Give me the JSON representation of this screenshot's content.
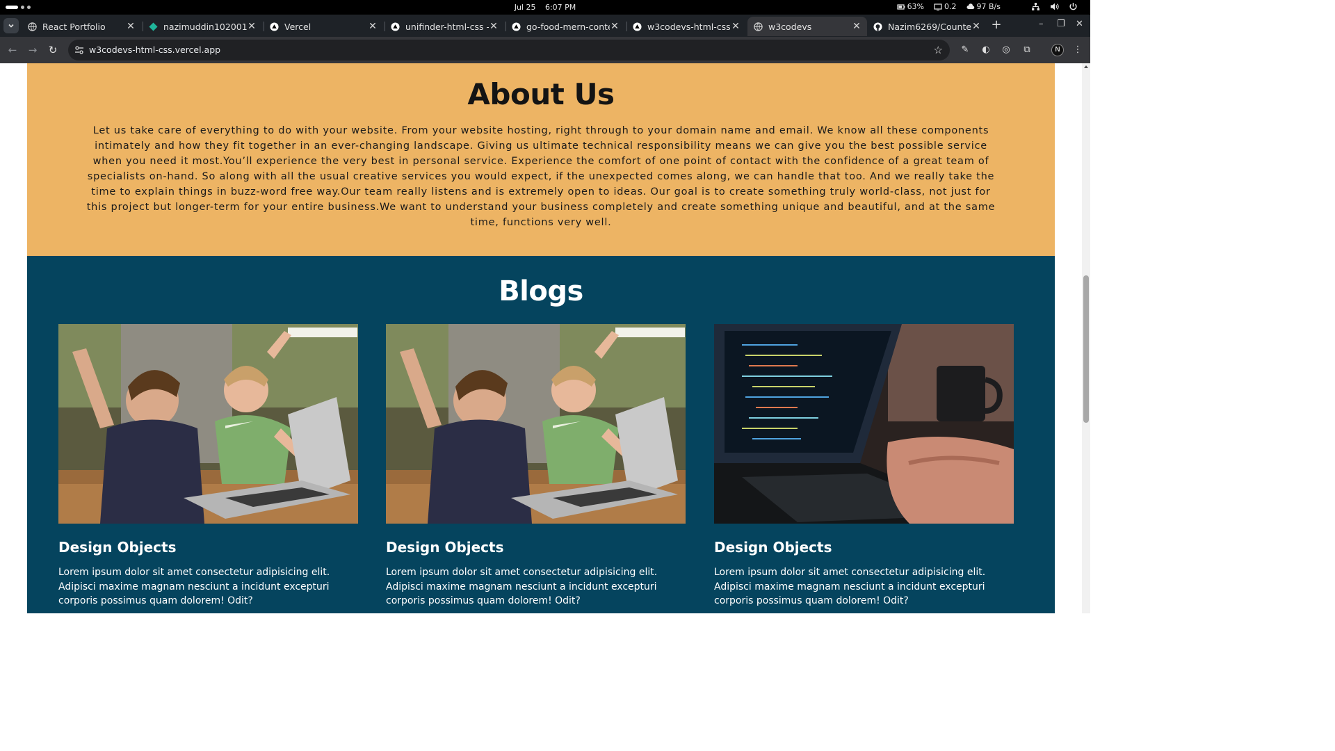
{
  "os": {
    "date": "Jul 25",
    "time": "6:07 PM",
    "battery": "63%",
    "cpu": "0.2",
    "network": "97 B/s"
  },
  "tabs": [
    {
      "title": "React Portfolio",
      "favicon": "globe-icon",
      "active": false
    },
    {
      "title": "nazimuddin102001 |",
      "favicon": "diamond-icon",
      "active": false
    },
    {
      "title": "Vercel",
      "favicon": "vercel-triangle-icon",
      "active": false
    },
    {
      "title": "unifinder-html-css - (",
      "favicon": "vercel-triangle-icon",
      "active": false
    },
    {
      "title": "go-food-mern-conte",
      "favicon": "vercel-triangle-icon",
      "active": false
    },
    {
      "title": "w3codevs-html-css -",
      "favicon": "vercel-triangle-icon",
      "active": false
    },
    {
      "title": "w3codevs",
      "favicon": "globe-icon",
      "active": true
    },
    {
      "title": "Nazim6269/Counter",
      "favicon": "github-icon",
      "active": false
    }
  ],
  "address": {
    "url": "w3codevs-html-css.vercel.app"
  },
  "profile": {
    "initial": "N"
  },
  "about": {
    "heading": "About Us",
    "body": "Let us take care of everything to do with your website. From your website hosting, right through to your domain name and email. We know all these components intimately and how they fit together in an ever-changing landscape. Giving us ultimate technical responsibility means we can give you the best possible service when you need it most.You’ll experience the very best in personal service. Experience the comfort of one point of contact with the confidence of a great team of specialists on-hand. So along with all the usual creative services you would expect, if the unexpected comes along, we can handle that too. And we really take the time to explain things in buzz-word free way.Our team really listens and is extremely open to ideas. Our goal is to create something truly world-class, not just for this project but longer-term for your entire business.We want to understand your business completely and create something unique and beautiful, and at the same time, functions very well."
  },
  "blogs": {
    "heading": "Blogs",
    "cards": [
      {
        "title": "Design Objects",
        "text": "Lorem ipsum dolor sit amet consectetur adipisicing elit. Adipisci maxime magnam nesciunt a incidunt excepturi corporis possimus quam dolorem! Odit?",
        "image": "kids-laptop-photo"
      },
      {
        "title": "Design Objects",
        "text": "Lorem ipsum dolor sit amet consectetur adipisicing elit. Adipisci maxime magnam nesciunt a incidunt excepturi corporis possimus quam dolorem! Odit?",
        "image": "kids-laptop-photo"
      },
      {
        "title": "Design Objects",
        "text": "Lorem ipsum dolor sit amet consectetur adipisicing elit. Adipisci maxime magnam nesciunt a incidunt excepturi corporis possimus quam dolorem! Odit?",
        "image": "coding-laptop-photo"
      }
    ]
  },
  "colors": {
    "about_bg": "#edb464",
    "blogs_bg": "#05445e",
    "tabstrip_bg": "#1e2227",
    "toolbar_bg": "#35363a"
  }
}
